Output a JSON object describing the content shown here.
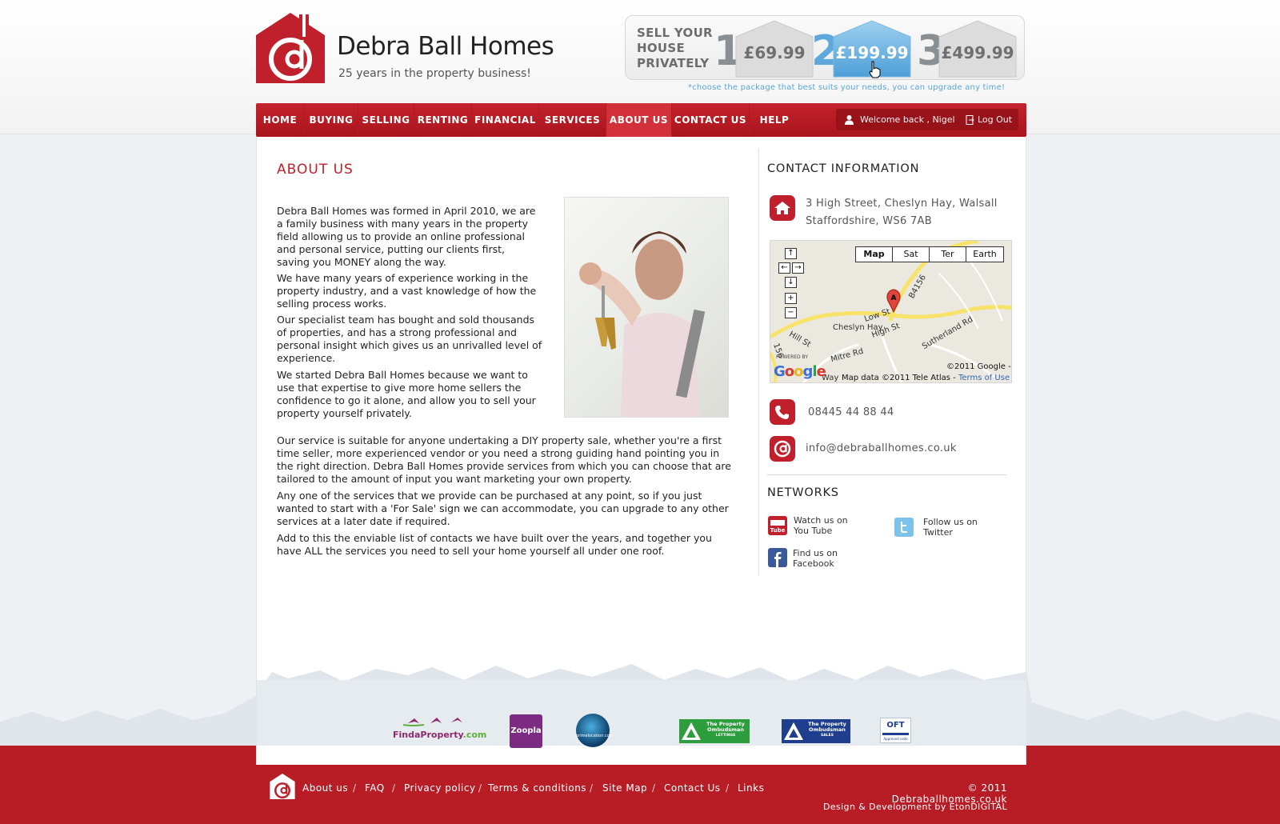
{
  "brand": {
    "name": "Debra Ball Homes",
    "tagline": "25 years in the property business!",
    "primary_color": "#c0202b",
    "accent_color": "#5da9dc"
  },
  "promo": {
    "label": "SELL YOUR\nHOUSE\nPRIVATELY",
    "packages": [
      {
        "number": "1",
        "price": "£69.99",
        "active": false
      },
      {
        "number": "2",
        "price": "£199.99",
        "active": true
      },
      {
        "number": "3",
        "price": "£499.99",
        "active": false
      }
    ],
    "note": "*choose the package that best suits your needs, you can upgrade any time!"
  },
  "nav": {
    "items": [
      "HOME",
      "BUYING",
      "SELLING",
      "RENTING",
      "FINANCIAL",
      "SERVICES",
      "ABOUT US",
      "CONTACT US",
      "HELP"
    ],
    "active": "ABOUT US",
    "welcome": "Welcome back , Nigel",
    "logout": "Log Out"
  },
  "about": {
    "heading": "ABOUT US",
    "paragraphs": [
      "Debra Ball Homes was formed in April 2010, we are a family business with many years in the property field allowing us to provide an online professional and personal service, putting our clients first, saving you MONEY along the way.",
      "We have many years of experience working in the property industry, and a vast knowledge of how the selling process works.",
      "Our specialist team has bought and sold thousands of properties, and has a strong professional and personal insight which gives us an unrivalled level of experience.",
      "We started Debra Ball Homes because we want to use that expertise to give more home sellers the confidence to go it alone, and allow you to sell your property yourself privately.",
      "Our service is suitable for anyone undertaking a DIY property sale, whether you're a first time seller, more experienced vendor or you need a strong guiding hand pointing you in the right direction. Debra Ball Homes provide services from which you can choose that are tailored to the amount of input you want marketing your own property.",
      "Any one of the services that we provide can be purchased at any point, so if you just wanted to start with a 'For Sale' sign we can accommodate, you can upgrade to any other services at a later date if required.",
      "Add to this the enviable list of contacts we have built over the years, and together you have ALL the services you need to sell your home yourself all under one roof."
    ]
  },
  "contact": {
    "heading": "CONTACT INFORMATION",
    "address_line1": "3 High Street, Cheslyn Hay, Walsall",
    "address_line2": "Staffordshire, WS6 7AB",
    "phone": "08445 44 88 44",
    "email": "info@debraballhomes.co.uk"
  },
  "map": {
    "types": [
      "Map",
      "Sat",
      "Ter",
      "Earth"
    ],
    "active_type": "Map",
    "marker": "A",
    "place_labels": [
      "Cheslyn Hay",
      "Low St",
      "High St",
      "Hill St",
      "Mitre Rd",
      "Sutherland Rd",
      "B4156",
      "156",
      "Way"
    ],
    "copyright": "©2011 Google -",
    "data_credit": "Map data ©2011 Tele Atlas -",
    "terms": "Terms of Use",
    "powered_by": "POWERED BY",
    "google": "Google"
  },
  "networks": {
    "heading": "NETWORKS",
    "items": [
      {
        "icon": "youtube-icon",
        "label": "Watch us on\nYou Tube"
      },
      {
        "icon": "twitter-icon",
        "label": "Follow us on\nTwitter"
      },
      {
        "icon": "facebook-icon",
        "label": "Find us on\nFacebook"
      }
    ]
  },
  "partners": [
    {
      "name": "FindaProperty",
      "text_a": "Finda",
      "text_b": "Property",
      "text_c": ".com"
    },
    {
      "name": "Zoopla",
      "text": "Zoopla"
    },
    {
      "name": "primelocation",
      "text": "primelocation.com"
    },
    {
      "name": "The Property Ombudsman Lettings",
      "line1": "The Property",
      "line2": "Ombudsman",
      "line3": "LETTINGS"
    },
    {
      "name": "The Property Ombudsman Sales",
      "line1": "The Property",
      "line2": "Ombudsman",
      "line3": "SALES"
    },
    {
      "name": "OFT",
      "text": "OFT",
      "sub": "Approved code"
    }
  ],
  "footer": {
    "links": [
      "About us",
      "FAQ",
      "Privacy policy",
      "Terms & conditions",
      "Site Map",
      "Contact Us",
      "Links"
    ],
    "separator": "/",
    "copyright": "© 2011 Debraballhomes.co.uk",
    "design": "Design & Development by EtonDIGITAL"
  }
}
